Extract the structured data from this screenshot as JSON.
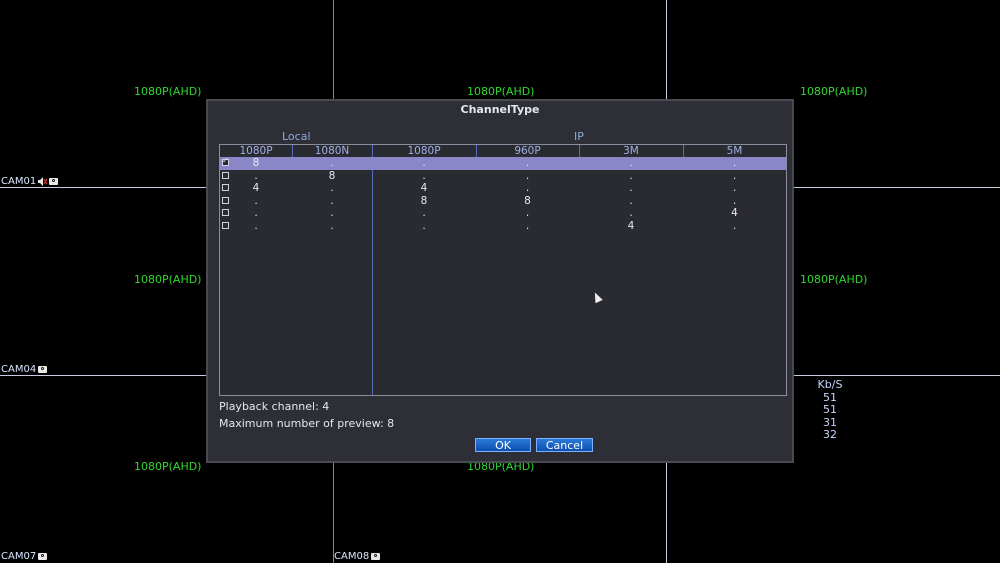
{
  "background": {
    "resolution_labels": [
      "1080P(AHD)",
      "1080P(AHD)",
      "1080P(AHD)",
      "1080P(AHD)",
      "1080P(AHD)",
      "1080P(AHD)",
      "1080P(AHD)"
    ],
    "cams": [
      "CAM01",
      "CAM04",
      "CAM07",
      "CAM08"
    ],
    "kbs": {
      "header": "Kb/S",
      "values": [
        "51",
        "51",
        "31",
        "32"
      ]
    }
  },
  "dialog": {
    "title": "ChannelType",
    "group_local": "Local",
    "group_ip": "IP",
    "columns": [
      "1080P",
      "1080N",
      "1080P",
      "960P",
      "3M",
      "5M"
    ],
    "rows": [
      {
        "checked": true,
        "selected": true,
        "values": [
          "8",
          ".",
          ".",
          ".",
          ".",
          "."
        ]
      },
      {
        "checked": false,
        "selected": false,
        "values": [
          ".",
          "8",
          ".",
          ".",
          ".",
          "."
        ]
      },
      {
        "checked": false,
        "selected": false,
        "values": [
          "4",
          ".",
          "4",
          ".",
          ".",
          "."
        ]
      },
      {
        "checked": false,
        "selected": false,
        "values": [
          ".",
          ".",
          "8",
          "8",
          ".",
          "."
        ]
      },
      {
        "checked": false,
        "selected": false,
        "values": [
          ".",
          ".",
          ".",
          ".",
          ".",
          "4"
        ]
      },
      {
        "checked": false,
        "selected": false,
        "values": [
          ".",
          ".",
          ".",
          ".",
          "4",
          "."
        ]
      }
    ],
    "playback": "Playback channel: 4",
    "max_preview": "Maximum number of preview: 8",
    "ok_label": "OK",
    "cancel_label": "Cancel"
  },
  "colors": {
    "accent_green": "#2fd82f",
    "selected_row": "#8a86c8",
    "button_blue": "#0d4fb0"
  }
}
